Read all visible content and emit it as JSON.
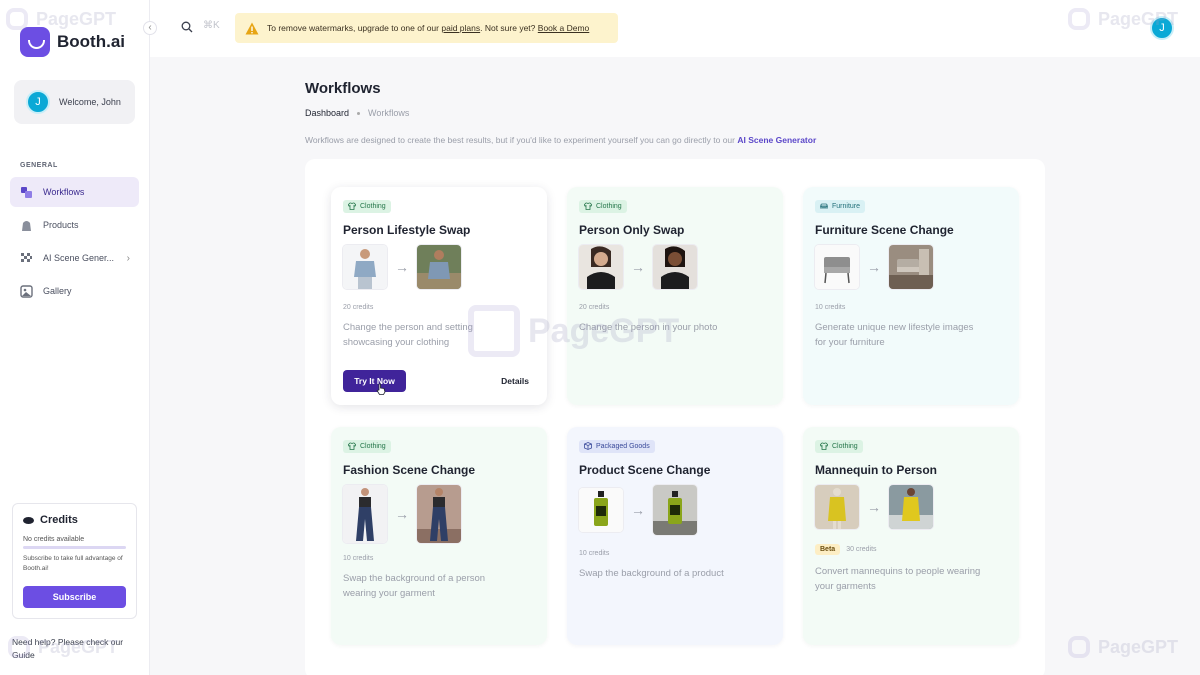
{
  "sidebar": {
    "collapse_icon": "chevron-left-icon",
    "logo_text": "Booth.ai",
    "welcome": {
      "avatar_initial": "J",
      "text": "Welcome, John"
    },
    "section_label": "GENERAL",
    "items": [
      {
        "label": "Workflows",
        "icon": "workflow-icon",
        "active": true
      },
      {
        "label": "Products",
        "icon": "products-icon",
        "active": false
      },
      {
        "label": "AI Scene Gener...",
        "icon": "ai-scene-icon",
        "active": false,
        "chevron": "›"
      },
      {
        "label": "Gallery",
        "icon": "gallery-icon",
        "active": false
      }
    ],
    "credits": {
      "title": "Credits",
      "status": "No credits available",
      "progress": 0,
      "subtitle": "Subscribe to take full advantage of Booth.ai!",
      "button": "Subscribe"
    },
    "help": {
      "text": "Need help? Please check our",
      "link": "Guide"
    }
  },
  "topbar": {
    "search_shortcut": "⌘K",
    "banner": {
      "text_before": "To remove watermarks, upgrade to one of our",
      "link1": "paid plans",
      "text_middle": ". Not sure yet?",
      "link2": "Book a Demo"
    },
    "avatar_initial": "J"
  },
  "main": {
    "title": "Workflows",
    "breadcrumb": [
      "Dashboard",
      "Workflows"
    ],
    "intro_text": "Workflows are designed to create the best results, but if you'd like to experiment yourself you can go directly to our",
    "intro_link": "AI Scene Generator",
    "cards": [
      {
        "tag": "Clothing",
        "title": "Person Lifestyle Swap",
        "credits": "20 credits",
        "description": "Change the person and setting showcasing your clothing",
        "try_label": "Try It Now",
        "details_label": "Details"
      },
      {
        "tag": "Clothing",
        "title": "Person Only Swap",
        "credits": "20 credits",
        "description": "Change the person in your photo"
      },
      {
        "tag": "Furniture",
        "title": "Furniture Scene Change",
        "credits": "10 credits",
        "description": "Generate unique new lifestyle images for your furniture"
      },
      {
        "tag": "Clothing",
        "title": "Fashion Scene Change",
        "credits": "10 credits",
        "description": "Swap the background of a person wearing your garment"
      },
      {
        "tag": "Packaged Goods",
        "title": "Product Scene Change",
        "credits": "10 credits",
        "description": "Swap the background of a product"
      },
      {
        "tag": "Clothing",
        "title": "Mannequin to Person",
        "badge": "Beta",
        "credits": "30 credits",
        "description": "Convert mannequins to people wearing your garments"
      }
    ],
    "arrow": "→"
  },
  "watermark": "PageGPT",
  "colors": {
    "accent": "#6c4ee3",
    "button_dark": "#40249a",
    "banner_bg": "#fdf3cd"
  }
}
